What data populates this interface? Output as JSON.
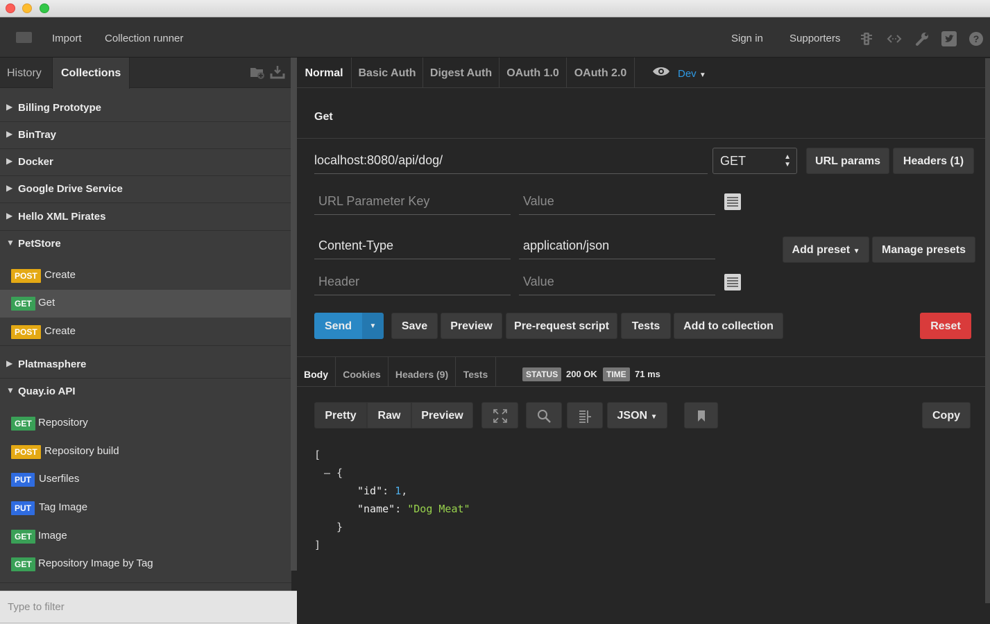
{
  "topnav": {
    "import": "Import",
    "collection_runner": "Collection runner",
    "sign_in": "Sign in",
    "supporters": "Supporters"
  },
  "sidebar": {
    "tab_history": "History",
    "tab_collections": "Collections",
    "filter_placeholder": "Type to filter",
    "collections": [
      {
        "name": "Billing Prototype",
        "expanded": false
      },
      {
        "name": "BinTray",
        "expanded": false
      },
      {
        "name": "Docker",
        "expanded": false
      },
      {
        "name": "Google Drive Service",
        "expanded": false
      },
      {
        "name": "Hello XML Pirates",
        "expanded": false
      },
      {
        "name": "PetStore",
        "expanded": true,
        "requests": [
          {
            "method": "POST",
            "name": "Create"
          },
          {
            "method": "GET",
            "name": "Get",
            "selected": true
          },
          {
            "method": "POST",
            "name": "Create"
          }
        ]
      },
      {
        "name": "Platmasphere",
        "expanded": false
      },
      {
        "name": "Quay.io API",
        "expanded": true,
        "requests": [
          {
            "method": "GET",
            "name": "Repository"
          },
          {
            "method": "POST",
            "name": "Repository build"
          },
          {
            "method": "PUT",
            "name": "Userfiles"
          },
          {
            "method": "PUT",
            "name": "Tag Image"
          },
          {
            "method": "GET",
            "name": "Image"
          },
          {
            "method": "GET",
            "name": "Repository Image by Tag"
          }
        ]
      }
    ]
  },
  "auth_tabs": [
    "Normal",
    "Basic Auth",
    "Digest Auth",
    "OAuth 1.0",
    "OAuth 2.0"
  ],
  "environment": "Dev",
  "request": {
    "title": "Get",
    "url": "localhost:8080/api/dog/",
    "method": "GET",
    "url_params_label": "URL params",
    "headers_label": "Headers (1)",
    "param_key_placeholder": "URL Parameter Key",
    "param_value_placeholder": "Value",
    "header_key": "Content-Type",
    "header_value": "application/json",
    "header_key_placeholder": "Header",
    "header_value_placeholder": "Value",
    "add_preset": "Add preset",
    "manage_presets": "Manage presets"
  },
  "actions": {
    "send": "Send",
    "save": "Save",
    "preview": "Preview",
    "pre_request": "Pre-request script",
    "tests": "Tests",
    "add_to_collection": "Add to collection",
    "reset": "Reset"
  },
  "response": {
    "tabs": [
      "Body",
      "Cookies",
      "Headers (9)",
      "Tests"
    ],
    "status_label": "STATUS",
    "status_value": "200 OK",
    "time_label": "TIME",
    "time_value": "71 ms",
    "view_modes": [
      "Pretty",
      "Raw",
      "Preview"
    ],
    "format": "JSON",
    "copy": "Copy",
    "body_lines": [
      {
        "indent": 0,
        "text": "["
      },
      {
        "indent": 1,
        "text": "– {"
      },
      {
        "indent": 2,
        "key": "\"id\"",
        "value": "1",
        "type": "num"
      },
      {
        "indent": 2,
        "key": "\"name\"",
        "value": "\"Dog Meat\"",
        "type": "str"
      },
      {
        "indent": 1,
        "text": "  }"
      },
      {
        "indent": 0,
        "text": "]"
      }
    ]
  },
  "colors": {
    "post": "#e4a914",
    "get": "#3aa057",
    "put": "#2f6ce0",
    "send": "#2a88c5",
    "reset": "#d93b3b",
    "env": "#2f9ae4"
  }
}
